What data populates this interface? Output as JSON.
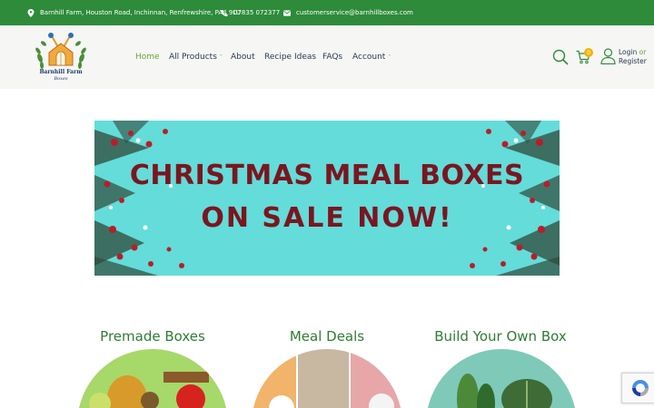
{
  "topbar": {
    "address": "Barnhill Farm, Houston Road, Inchinnan, Renfrewshire, PA4 9LU",
    "phone": "07835 072377",
    "email": "customerservice@barnhillboxes.com"
  },
  "logo": {
    "line1": "Barnhill Farm",
    "line2": "Boxes"
  },
  "nav": {
    "items": [
      {
        "label": "Home",
        "active": true
      },
      {
        "label": "All Products",
        "dropdown": true
      },
      {
        "label": "About"
      },
      {
        "label": "Recipe Ideas"
      },
      {
        "label": "FAQs"
      },
      {
        "label": "Account",
        "dropdown": true
      }
    ]
  },
  "header": {
    "cart_count": "0",
    "login_label": "Login",
    "or_label": "or",
    "register_label": "Register"
  },
  "banner": {
    "line1": "CHRISTMAS MEAL BOXES",
    "line2": "ON SALE NOW!"
  },
  "categories": [
    {
      "title": "Premade Boxes"
    },
    {
      "title": "Meal Deals"
    },
    {
      "title": "Build Your Own Box"
    }
  ],
  "colors": {
    "topbar_bg": "#2e8b3a",
    "accent_green": "#6aa338",
    "title_green": "#2e7d32",
    "banner_bg": "#64dcd9",
    "banner_text": "#7a1620",
    "badge": "#f0b400"
  }
}
